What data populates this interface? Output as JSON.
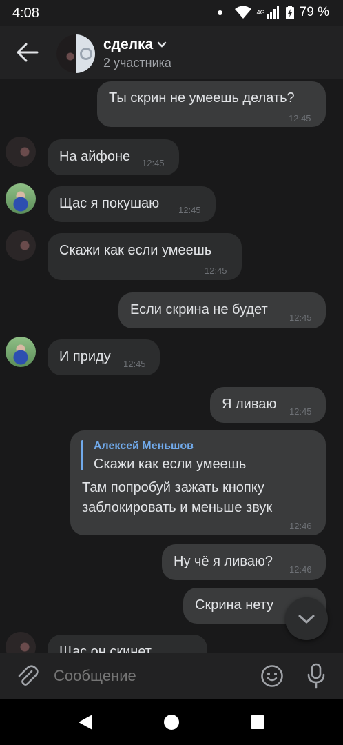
{
  "status": {
    "time": "4:08",
    "network": "4G",
    "battery": "79 %"
  },
  "header": {
    "title": "сделка",
    "subtitle": "2 участника"
  },
  "messages": [
    {
      "dir": "out",
      "text": "Ты скрин не умеешь делать?",
      "time": "12:45"
    },
    {
      "dir": "in",
      "avatar": "dark",
      "text": "На айфоне",
      "time": "12:45"
    },
    {
      "dir": "in",
      "avatar": "green",
      "text": "Щас я покушаю",
      "time": "12:45"
    },
    {
      "dir": "in",
      "avatar": "dark",
      "text": "Скажи как если умеешь",
      "time": "12:45"
    },
    {
      "dir": "out",
      "text": "Если скрина не будет",
      "time": "12:45"
    },
    {
      "dir": "in",
      "avatar": "green",
      "text": "И приду",
      "time": "12:45"
    },
    {
      "dir": "out",
      "text": "Я ливаю",
      "time": "12:45"
    },
    {
      "dir": "out",
      "reply_name": "Алексей Меньшов",
      "reply_text": "Скажи как если умеешь",
      "line1": "Там попробуй зажать кнопку",
      "line2": "заблокировать и меньше звук",
      "time": "12:46"
    },
    {
      "dir": "out",
      "text": "Ну чё я ливаю?",
      "time": "12:46"
    },
    {
      "dir": "out",
      "text": "Скрина нету",
      "time": ""
    },
    {
      "dir": "in",
      "avatar": "dark",
      "text": "Щас он скинет",
      "time": ""
    }
  ],
  "composer": {
    "placeholder": "Сообщение"
  },
  "icons": {
    "back": "back-arrow-icon",
    "dropdown": "chevron-down-icon",
    "attach": "paperclip-icon",
    "emoji": "smiley-icon",
    "mic": "microphone-icon",
    "scroll_down": "chevron-down-icon"
  },
  "colors": {
    "background": "#19191a",
    "bubble_in": "#2c2d2e",
    "bubble_out": "#3a3b3c",
    "accent": "#71aaeb"
  }
}
